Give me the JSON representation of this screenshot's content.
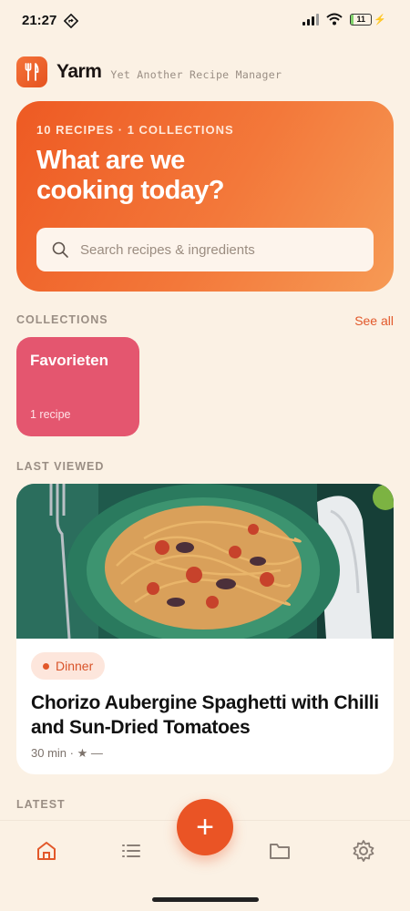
{
  "status_bar": {
    "time": "21:27",
    "battery_level": "11",
    "battery_fraction": 0.11,
    "icons": [
      "navigation-icon",
      "signal-icon",
      "wifi-icon",
      "battery-icon",
      "charging-icon"
    ]
  },
  "app": {
    "name": "Yarm",
    "tagline": "Yet Another Recipe Manager"
  },
  "hero": {
    "meta": "10 RECIPES · 1 COLLECTIONS",
    "title_line1": "What are we",
    "title_line2": "cooking today?",
    "search_placeholder": "Search recipes & ingredients"
  },
  "collections": {
    "heading": "COLLECTIONS",
    "see_all": "See all",
    "items": [
      {
        "name": "Favorieten",
        "count": "1 recipe",
        "color": "#e4566f"
      }
    ]
  },
  "last_viewed": {
    "heading": "LAST VIEWED",
    "recipe": {
      "tag": "Dinner",
      "title": "Chorizo Aubergine Spaghetti with Chilli and Sun-Dried Tomatoes",
      "meta": "30 min · ★ —"
    }
  },
  "latest": {
    "heading": "LATEST"
  },
  "tab_bar": {
    "tabs": [
      "home-icon",
      "list-icon",
      "add-icon",
      "folder-icon",
      "settings-icon"
    ],
    "fab_label": "+"
  },
  "colors": {
    "accent": "#ea5425",
    "background": "#fbf1e4",
    "collection": "#e4566f"
  }
}
